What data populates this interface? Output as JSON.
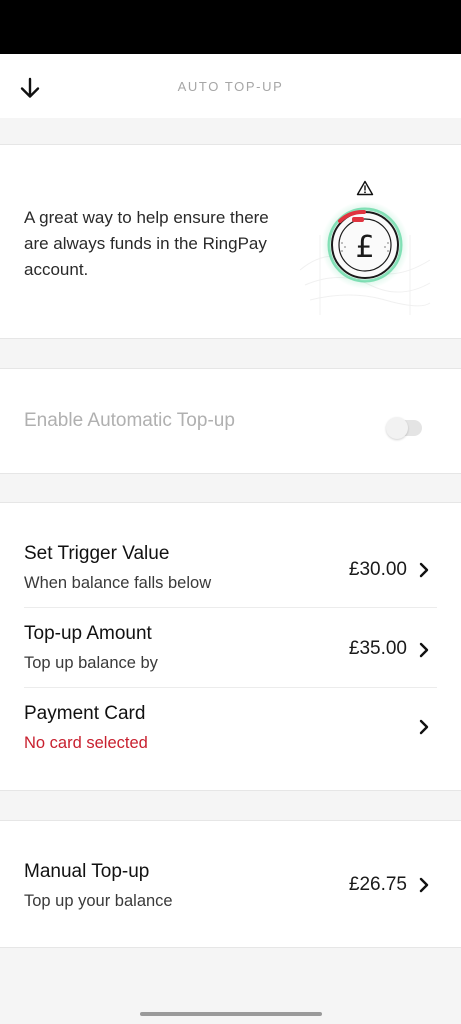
{
  "header": {
    "title": "AUTO TOP-UP"
  },
  "info": {
    "description": "A great way to help ensure there are always funds in the RingPay account.",
    "warning_glyph": "⚠"
  },
  "enable": {
    "label": "Enable Automatic Top-up",
    "enabled": false
  },
  "settings": [
    {
      "title": "Set Trigger Value",
      "subtitle": "When balance falls below",
      "value": "£30.00"
    },
    {
      "title": "Top-up Amount",
      "subtitle": "Top up balance by",
      "value": "£35.00"
    },
    {
      "title": "Payment Card",
      "subtitle": "No card selected",
      "value": ""
    }
  ],
  "manual": {
    "title": "Manual Top-up",
    "subtitle": "Top up your balance",
    "value": "£26.75"
  },
  "colors": {
    "error": "#c8202f",
    "ring_glow": "#3ecf8e",
    "ring_alert": "#e0343f"
  }
}
